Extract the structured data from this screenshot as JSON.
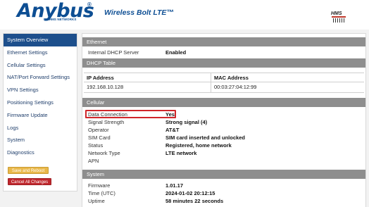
{
  "header": {
    "logo_text": "Anybus",
    "logo_reg": "®",
    "logo_sub": "BY HMS NETWORKS",
    "product": "Wireless Bolt LTE™",
    "hms_text": "HMS"
  },
  "sidebar": {
    "items": [
      {
        "label": "System Overview",
        "active": true
      },
      {
        "label": "Ethernet Settings"
      },
      {
        "label": "Cellular Settings"
      },
      {
        "label": "NAT/Port Forward Settings"
      },
      {
        "label": "VPN Settings"
      },
      {
        "label": "Positioning Settings"
      },
      {
        "label": "Firmware Update"
      },
      {
        "label": "Logs"
      },
      {
        "label": "System"
      },
      {
        "label": "Diagnostics"
      }
    ],
    "save_label": "Save and Reboot",
    "cancel_label": "Cancel All Changes"
  },
  "ethernet": {
    "title": "Ethernet",
    "dhcp_label": "Internal DHCP Server",
    "dhcp_value": "Enabled"
  },
  "dhcp_table": {
    "title": "DHCP Table",
    "columns": [
      "IP Address",
      "MAC Address"
    ],
    "rows": [
      [
        "192.168.10.128",
        "00:03:27:04:12:99"
      ]
    ]
  },
  "cellular": {
    "title": "Cellular",
    "fields": [
      {
        "label": "Data Connection",
        "value": "Yes"
      },
      {
        "label": "Signal Strength",
        "value": "Strong signal (4)"
      },
      {
        "label": "Operator",
        "value": "AT&T"
      },
      {
        "label": "SIM Card",
        "value": "SIM card inserted and unlocked"
      },
      {
        "label": "Status",
        "value": "Registered, home network"
      },
      {
        "label": "Network Type",
        "value": "LTE network"
      },
      {
        "label": "APN",
        "value": ""
      }
    ]
  },
  "system": {
    "title": "System",
    "fields": [
      {
        "label": "Firmware",
        "value": "1.01.17"
      },
      {
        "label": "Time (UTC)",
        "value": "2024-01-02 20:12:15"
      },
      {
        "label": "Uptime",
        "value": "58 minutes 22 seconds"
      }
    ]
  },
  "colors": {
    "brand_blue": "#0d4e93",
    "nav_active": "#1d4f8c",
    "section_header": "#8e8e8e",
    "save_button": "#e9b84a",
    "cancel_button": "#c0272d",
    "highlight": "#d0262a"
  }
}
